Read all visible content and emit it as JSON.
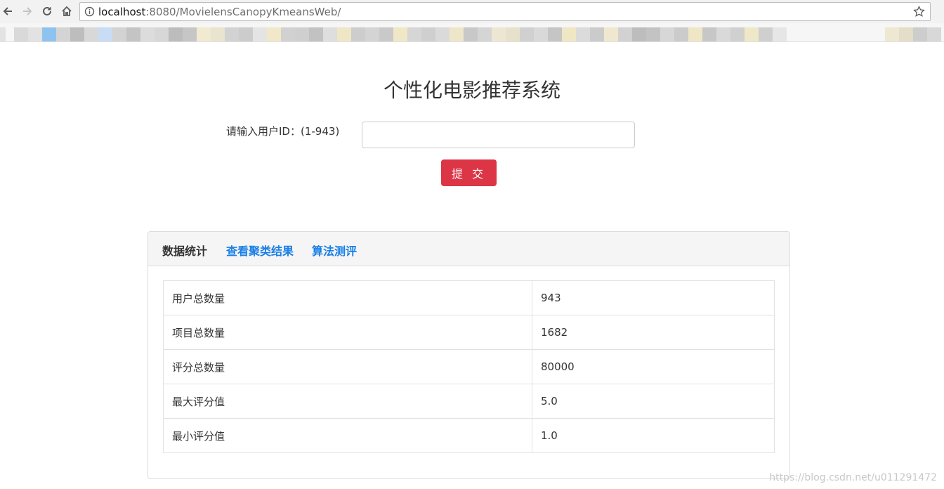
{
  "browser": {
    "url_host": "localhost",
    "url_path": ":8080/MovielensCanopyKmeansWeb/"
  },
  "page": {
    "title": "个性化电影推荐系统",
    "form": {
      "label": "请输入用户ID：(1-943)",
      "input_value": "",
      "submit_label": "提 交"
    },
    "tabs": [
      {
        "label": "数据统计",
        "active": true
      },
      {
        "label": "查看聚类结果",
        "active": false
      },
      {
        "label": "算法测评",
        "active": false
      }
    ],
    "stats": [
      {
        "key": "用户总数量",
        "value": "943"
      },
      {
        "key": "项目总数量",
        "value": "1682"
      },
      {
        "key": "评分总数量",
        "value": "80000"
      },
      {
        "key": "最大评分值",
        "value": "5.0"
      },
      {
        "key": "最小评分值",
        "value": "1.0"
      }
    ]
  },
  "watermark": "https://blog.csdn.net/u011291472",
  "icons": [
    "back-icon",
    "forward-icon",
    "reload-icon",
    "home-icon",
    "info-icon",
    "star-icon"
  ],
  "colors": {
    "primary_button": "#dc3545",
    "tab_link": "#1a7fe6",
    "card_header_bg": "#f5f5f5"
  }
}
